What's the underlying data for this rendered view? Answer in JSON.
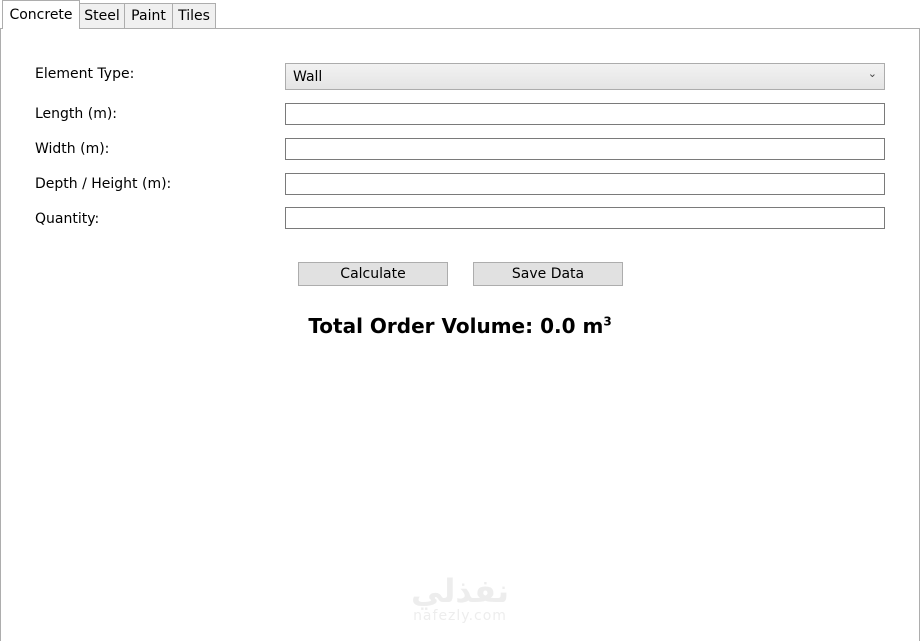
{
  "tabs": [
    {
      "label": "Concrete",
      "active": true
    },
    {
      "label": "Steel",
      "active": false
    },
    {
      "label": "Paint",
      "active": false
    },
    {
      "label": "Tiles",
      "active": false
    }
  ],
  "form": {
    "element_type_label": "Element Type:",
    "element_type_value": "Wall",
    "length_label": "Length (m):",
    "length_value": "",
    "width_label": "Width (m):",
    "width_value": "",
    "depth_label": "Depth / Height (m):",
    "depth_value": "",
    "quantity_label": "Quantity:",
    "quantity_value": ""
  },
  "buttons": {
    "calculate": "Calculate",
    "save": "Save Data"
  },
  "result": {
    "prefix": "Total Order Volume: 0.0 m",
    "superscript": "3"
  },
  "watermark": {
    "arabic": "نفذلي",
    "latin": "nafezly.com"
  },
  "icons": {
    "dropdown": "chevron-down-icon"
  }
}
